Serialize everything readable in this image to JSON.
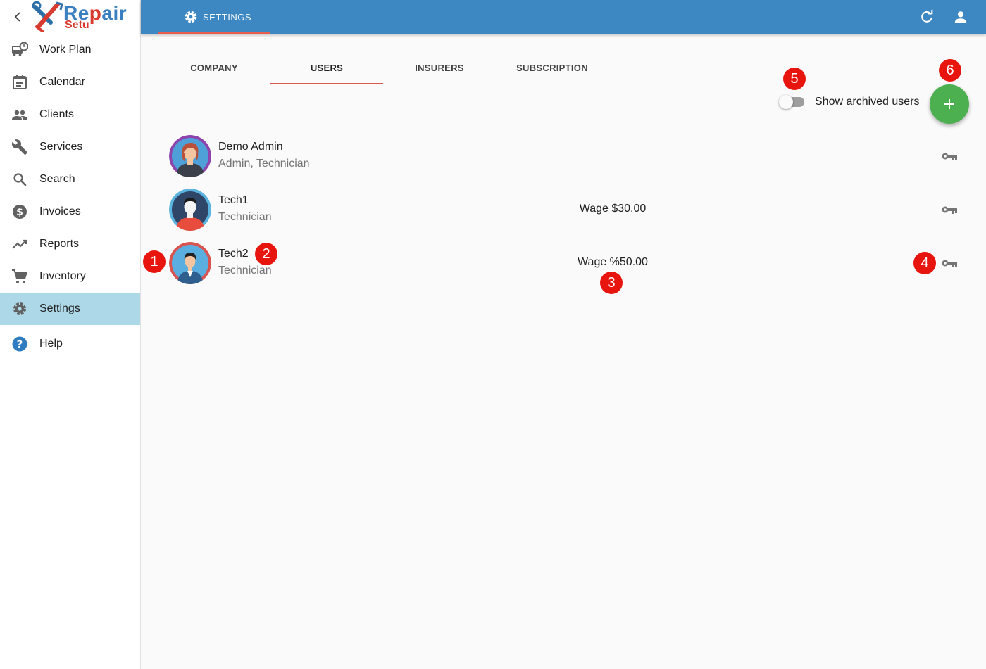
{
  "sidebar": {
    "logo": {
      "line1_part1": "Re",
      "line1_part2": "p",
      "line1_part3": "air",
      "line2": "Setu"
    },
    "items": [
      {
        "label": "Work Plan",
        "icon": "bus-clock-icon"
      },
      {
        "label": "Calendar",
        "icon": "calendar-icon"
      },
      {
        "label": "Clients",
        "icon": "people-icon"
      },
      {
        "label": "Services",
        "icon": "wrench-icon"
      },
      {
        "label": "Search",
        "icon": "search-icon"
      },
      {
        "label": "Invoices",
        "icon": "dollar-circle-icon"
      },
      {
        "label": "Reports",
        "icon": "trending-up-icon"
      },
      {
        "label": "Inventory",
        "icon": "cart-icon"
      },
      {
        "label": "Settings",
        "icon": "gear-icon",
        "active": true
      },
      {
        "label": "Help",
        "icon": "help-circle-icon"
      }
    ]
  },
  "appbar": {
    "title": "SETTINGS"
  },
  "tabs": [
    {
      "label": "COMPANY"
    },
    {
      "label": "USERS",
      "active": true
    },
    {
      "label": "INSURERS"
    },
    {
      "label": "SUBSCRIPTION"
    }
  ],
  "archived_toggle": {
    "label": "Show archived users",
    "checked": false
  },
  "users": [
    {
      "name": "Demo Admin",
      "role": "Admin, Technician",
      "wage": ""
    },
    {
      "name": "Tech1",
      "role": "Technician",
      "wage": "Wage $30.00"
    },
    {
      "name": "Tech2",
      "role": "Technician",
      "wage": "Wage %50.00"
    }
  ],
  "annotations": [
    "1",
    "2",
    "3",
    "4",
    "5",
    "6"
  ],
  "colors": {
    "appbar": "#3d88c2",
    "active_nav": "#acd8e8",
    "tab_indicator": "#e05a4e",
    "fab": "#4caf50",
    "badge": "#e8150e"
  }
}
